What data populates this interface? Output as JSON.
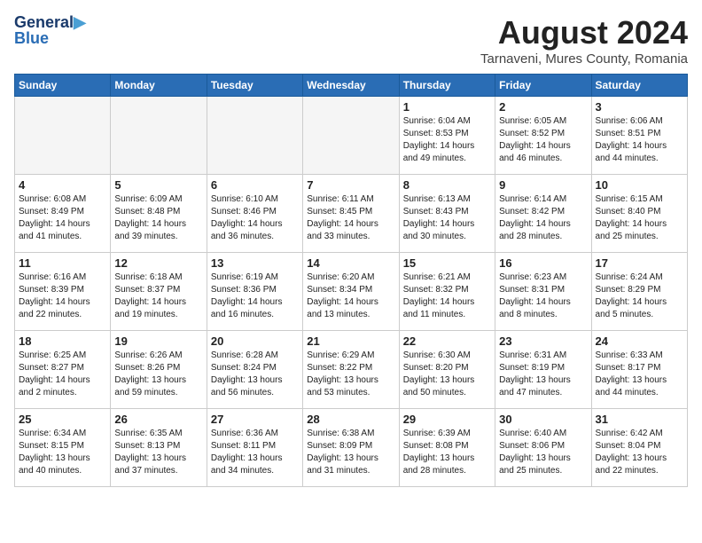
{
  "header": {
    "logo_line1": "General",
    "logo_line2": "Blue",
    "title": "August 2024",
    "subtitle": "Tarnaveni, Mures County, Romania"
  },
  "weekdays": [
    "Sunday",
    "Monday",
    "Tuesday",
    "Wednesday",
    "Thursday",
    "Friday",
    "Saturday"
  ],
  "weeks": [
    [
      {
        "day": "",
        "info": ""
      },
      {
        "day": "",
        "info": ""
      },
      {
        "day": "",
        "info": ""
      },
      {
        "day": "",
        "info": ""
      },
      {
        "day": "1",
        "info": "Sunrise: 6:04 AM\nSunset: 8:53 PM\nDaylight: 14 hours\nand 49 minutes."
      },
      {
        "day": "2",
        "info": "Sunrise: 6:05 AM\nSunset: 8:52 PM\nDaylight: 14 hours\nand 46 minutes."
      },
      {
        "day": "3",
        "info": "Sunrise: 6:06 AM\nSunset: 8:51 PM\nDaylight: 14 hours\nand 44 minutes."
      }
    ],
    [
      {
        "day": "4",
        "info": "Sunrise: 6:08 AM\nSunset: 8:49 PM\nDaylight: 14 hours\nand 41 minutes."
      },
      {
        "day": "5",
        "info": "Sunrise: 6:09 AM\nSunset: 8:48 PM\nDaylight: 14 hours\nand 39 minutes."
      },
      {
        "day": "6",
        "info": "Sunrise: 6:10 AM\nSunset: 8:46 PM\nDaylight: 14 hours\nand 36 minutes."
      },
      {
        "day": "7",
        "info": "Sunrise: 6:11 AM\nSunset: 8:45 PM\nDaylight: 14 hours\nand 33 minutes."
      },
      {
        "day": "8",
        "info": "Sunrise: 6:13 AM\nSunset: 8:43 PM\nDaylight: 14 hours\nand 30 minutes."
      },
      {
        "day": "9",
        "info": "Sunrise: 6:14 AM\nSunset: 8:42 PM\nDaylight: 14 hours\nand 28 minutes."
      },
      {
        "day": "10",
        "info": "Sunrise: 6:15 AM\nSunset: 8:40 PM\nDaylight: 14 hours\nand 25 minutes."
      }
    ],
    [
      {
        "day": "11",
        "info": "Sunrise: 6:16 AM\nSunset: 8:39 PM\nDaylight: 14 hours\nand 22 minutes."
      },
      {
        "day": "12",
        "info": "Sunrise: 6:18 AM\nSunset: 8:37 PM\nDaylight: 14 hours\nand 19 minutes."
      },
      {
        "day": "13",
        "info": "Sunrise: 6:19 AM\nSunset: 8:36 PM\nDaylight: 14 hours\nand 16 minutes."
      },
      {
        "day": "14",
        "info": "Sunrise: 6:20 AM\nSunset: 8:34 PM\nDaylight: 14 hours\nand 13 minutes."
      },
      {
        "day": "15",
        "info": "Sunrise: 6:21 AM\nSunset: 8:32 PM\nDaylight: 14 hours\nand 11 minutes."
      },
      {
        "day": "16",
        "info": "Sunrise: 6:23 AM\nSunset: 8:31 PM\nDaylight: 14 hours\nand 8 minutes."
      },
      {
        "day": "17",
        "info": "Sunrise: 6:24 AM\nSunset: 8:29 PM\nDaylight: 14 hours\nand 5 minutes."
      }
    ],
    [
      {
        "day": "18",
        "info": "Sunrise: 6:25 AM\nSunset: 8:27 PM\nDaylight: 14 hours\nand 2 minutes."
      },
      {
        "day": "19",
        "info": "Sunrise: 6:26 AM\nSunset: 8:26 PM\nDaylight: 13 hours\nand 59 minutes."
      },
      {
        "day": "20",
        "info": "Sunrise: 6:28 AM\nSunset: 8:24 PM\nDaylight: 13 hours\nand 56 minutes."
      },
      {
        "day": "21",
        "info": "Sunrise: 6:29 AM\nSunset: 8:22 PM\nDaylight: 13 hours\nand 53 minutes."
      },
      {
        "day": "22",
        "info": "Sunrise: 6:30 AM\nSunset: 8:20 PM\nDaylight: 13 hours\nand 50 minutes."
      },
      {
        "day": "23",
        "info": "Sunrise: 6:31 AM\nSunset: 8:19 PM\nDaylight: 13 hours\nand 47 minutes."
      },
      {
        "day": "24",
        "info": "Sunrise: 6:33 AM\nSunset: 8:17 PM\nDaylight: 13 hours\nand 44 minutes."
      }
    ],
    [
      {
        "day": "25",
        "info": "Sunrise: 6:34 AM\nSunset: 8:15 PM\nDaylight: 13 hours\nand 40 minutes."
      },
      {
        "day": "26",
        "info": "Sunrise: 6:35 AM\nSunset: 8:13 PM\nDaylight: 13 hours\nand 37 minutes."
      },
      {
        "day": "27",
        "info": "Sunrise: 6:36 AM\nSunset: 8:11 PM\nDaylight: 13 hours\nand 34 minutes."
      },
      {
        "day": "28",
        "info": "Sunrise: 6:38 AM\nSunset: 8:09 PM\nDaylight: 13 hours\nand 31 minutes."
      },
      {
        "day": "29",
        "info": "Sunrise: 6:39 AM\nSunset: 8:08 PM\nDaylight: 13 hours\nand 28 minutes."
      },
      {
        "day": "30",
        "info": "Sunrise: 6:40 AM\nSunset: 8:06 PM\nDaylight: 13 hours\nand 25 minutes."
      },
      {
        "day": "31",
        "info": "Sunrise: 6:42 AM\nSunset: 8:04 PM\nDaylight: 13 hours\nand 22 minutes."
      }
    ]
  ]
}
